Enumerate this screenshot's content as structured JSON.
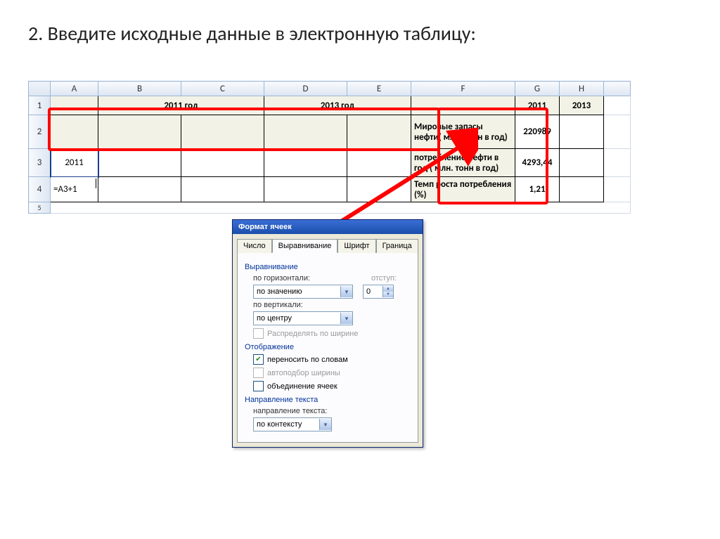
{
  "title": "2. Введите исходные данные в электронную таблицу:",
  "columns": [
    "A",
    "B",
    "C",
    "D",
    "E",
    "F",
    "G",
    "H"
  ],
  "rows": [
    "1",
    "2",
    "3",
    "4",
    "5"
  ],
  "sheet": {
    "r1": {
      "BC": "2011 год",
      "DE": "2013 год",
      "G": "2011",
      "H": "2013"
    },
    "r2": {
      "F": "Мировые запасы нефти( млн. тонн в год)",
      "G": "220989"
    },
    "r3": {
      "A": "2011",
      "F": "потребление нефти в год ( млн. тонн в год)",
      "G": "4293,44"
    },
    "r4": {
      "A": "=A3+1",
      "F": "Темп роста потребления (%)",
      "G": "1,21"
    }
  },
  "dialog": {
    "title": "Формат ячеек",
    "tabs": {
      "t1": "Число",
      "t2": "Выравнивание",
      "t3": "Шрифт",
      "t4": "Граница"
    },
    "g_align": "Выравнивание",
    "lbl_horiz": "по горизонтали:",
    "val_horiz": "по значению",
    "lbl_indent": "отступ:",
    "val_indent": "0",
    "lbl_vert": "по вертикали:",
    "val_vert": "по центру",
    "chk_dist": "Распределять по ширине",
    "g_display": "Отображение",
    "chk_wrap": "переносить по словам",
    "chk_autofit": "автоподбор ширины",
    "chk_merge": "объединение ячеек",
    "g_dir": "Направление текста",
    "lbl_dir": "направление текста:",
    "val_dir": "по контексту"
  }
}
